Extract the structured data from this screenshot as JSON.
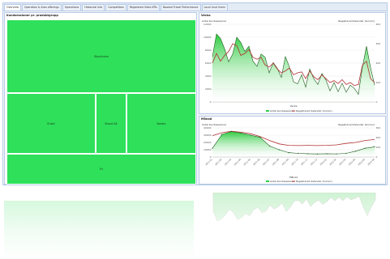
{
  "tabs": [
    {
      "label": "Overview",
      "active": true
    },
    {
      "label": "Operation & Area offerings",
      "active": false
    },
    {
      "label": "Operations",
      "active": false
    },
    {
      "label": "Historical Info",
      "active": false
    },
    {
      "label": "Competitors",
      "active": false
    },
    {
      "label": "Registered Visits KPIs",
      "active": false
    },
    {
      "label": "Booked Travel Performance",
      "active": false
    },
    {
      "label": "Local fund Users",
      "active": false
    }
  ],
  "treemap_panel": {
    "title": "Kundsessioner pr. produktgrupp",
    "tiles": [
      {
        "label": "Stockholm"
      },
      {
        "label": "Enkel"
      },
      {
        "label": "Stand Alt"
      },
      {
        "label": "Bastro"
      },
      {
        "label": "Fri"
      }
    ]
  },
  "colors": {
    "tile": "#2ee05a",
    "area": "#2ecc40",
    "line": "#b03030"
  },
  "chart_data": [
    {
      "type": "line",
      "title": "Vecka",
      "ylabel": "Antal kundsessioner",
      "y2label": "Registrerad Kalender (tunnor)",
      "xlabel": "Vecka",
      "ylim": [
        0,
        12000
      ],
      "y2lim": [
        0,
        400
      ],
      "yticks": [
        "0",
        "2000",
        "4000",
        "6000",
        "8000",
        "10000",
        "12000"
      ],
      "y2ticks": [
        "0",
        "100",
        "200",
        "300",
        "400"
      ],
      "series": [
        {
          "name": "Antal kundsessioner",
          "kind": "area",
          "values": [
            7000,
            10500,
            9800,
            8200,
            6200,
            7400,
            10000,
            9200,
            7800,
            8600,
            6300,
            5500,
            7400,
            6900,
            4500,
            6100,
            5200,
            3800,
            7000,
            5400,
            3100,
            2800,
            4200,
            2300,
            5100,
            3600,
            2700,
            4400,
            3400,
            1700,
            3000,
            1600,
            2900,
            1500,
            2600,
            2100,
            1200,
            5400,
            8600,
            5300,
            2600
          ]
        },
        {
          "name": "Registrerad Kalender (tunnor)",
          "kind": "line",
          "values": [
            200,
            250,
            210,
            240,
            260,
            300,
            290,
            240,
            250,
            270,
            230,
            220,
            230,
            190,
            180,
            200,
            170,
            150,
            160,
            175,
            140,
            150,
            155,
            120,
            160,
            130,
            115,
            140,
            120,
            100,
            110,
            95,
            115,
            90,
            100,
            85,
            90,
            190,
            210,
            120,
            100
          ]
        }
      ]
    },
    {
      "type": "line",
      "title": "Månad",
      "ylabel": "Antal kundsessioner",
      "y2label": "Registrerad Kalender (tunnor)",
      "xlabel": "Månad",
      "ylim": [
        0,
        40000
      ],
      "y2lim": [
        0,
        300
      ],
      "yticks": [
        "0",
        "10000",
        "20000",
        "30000",
        "40000"
      ],
      "y2ticks": [
        "0",
        "100",
        "200",
        "300"
      ],
      "x": [
        "2011-01",
        "2011-02",
        "2011-03",
        "2011-04",
        "2011-05",
        "2011-06",
        "2011-07",
        "2011-08",
        "2011-09",
        "2011-10",
        "2011-11",
        "2011-12",
        "2012-01",
        "2012-02",
        "2012-03",
        "2012-04",
        "2012-05",
        "2012-06"
      ],
      "series": [
        {
          "name": "Antal kundsessioner",
          "kind": "area",
          "values": [
            12000,
            31000,
            35000,
            33000,
            30000,
            27000,
            15000,
            10000,
            6000,
            5000,
            4500,
            4200,
            4500,
            4300,
            5000,
            8000,
            12000,
            14000
          ]
        },
        {
          "name": "Registrerad Kalender (tunnor)",
          "kind": "line",
          "values": [
            220,
            250,
            265,
            255,
            240,
            210,
            170,
            135,
            120,
            118,
            120,
            118,
            120,
            125,
            140,
            150,
            170,
            180
          ]
        }
      ]
    }
  ]
}
